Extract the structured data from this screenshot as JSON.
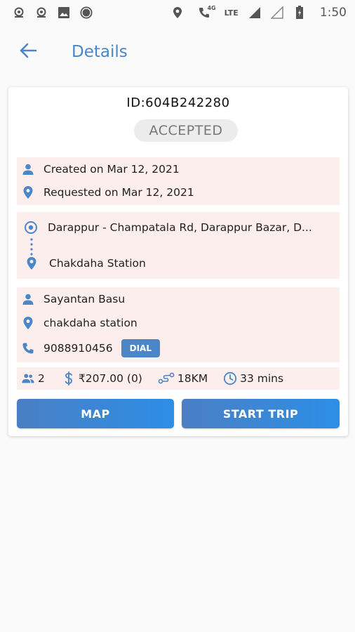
{
  "status_bar": {
    "time": "1:50",
    "network": "LTE",
    "network_small": "4G",
    "left_icons": [
      "notification-icon",
      "notification-icon",
      "image-icon",
      "circle-icon"
    ],
    "right_icons": [
      "location-icon",
      "call-icon",
      "signal-icon",
      "signal-empty-icon",
      "battery-icon"
    ]
  },
  "app_bar": {
    "title": "Details",
    "back_icon": "arrow-back-icon",
    "accent": "#4a86c8"
  },
  "trip": {
    "id_text": "ID:604B242280",
    "status": "ACCEPTED",
    "created": "Created on Mar 12, 2021",
    "requested": "Requested on Mar 12, 2021",
    "pickup": "Darappur - Champatala Rd, Darappur Bazar, D...",
    "drop": "Chakdaha Station",
    "customer_name": "Sayantan Basu",
    "customer_location": "chakdaha station",
    "phone": "9088910456",
    "dial_label": "DIAL",
    "passengers": "2",
    "fare": "₹207.00 (0)",
    "distance": "18KM",
    "duration": "33 mins"
  },
  "actions": {
    "map_label": "MAP",
    "start_label": "START TRIP"
  },
  "colors": {
    "section_bg": "#fdeeee",
    "icon_blue": "#4a86c8",
    "button_start": "#4a7fc4",
    "button_end": "#2d8ee6"
  }
}
